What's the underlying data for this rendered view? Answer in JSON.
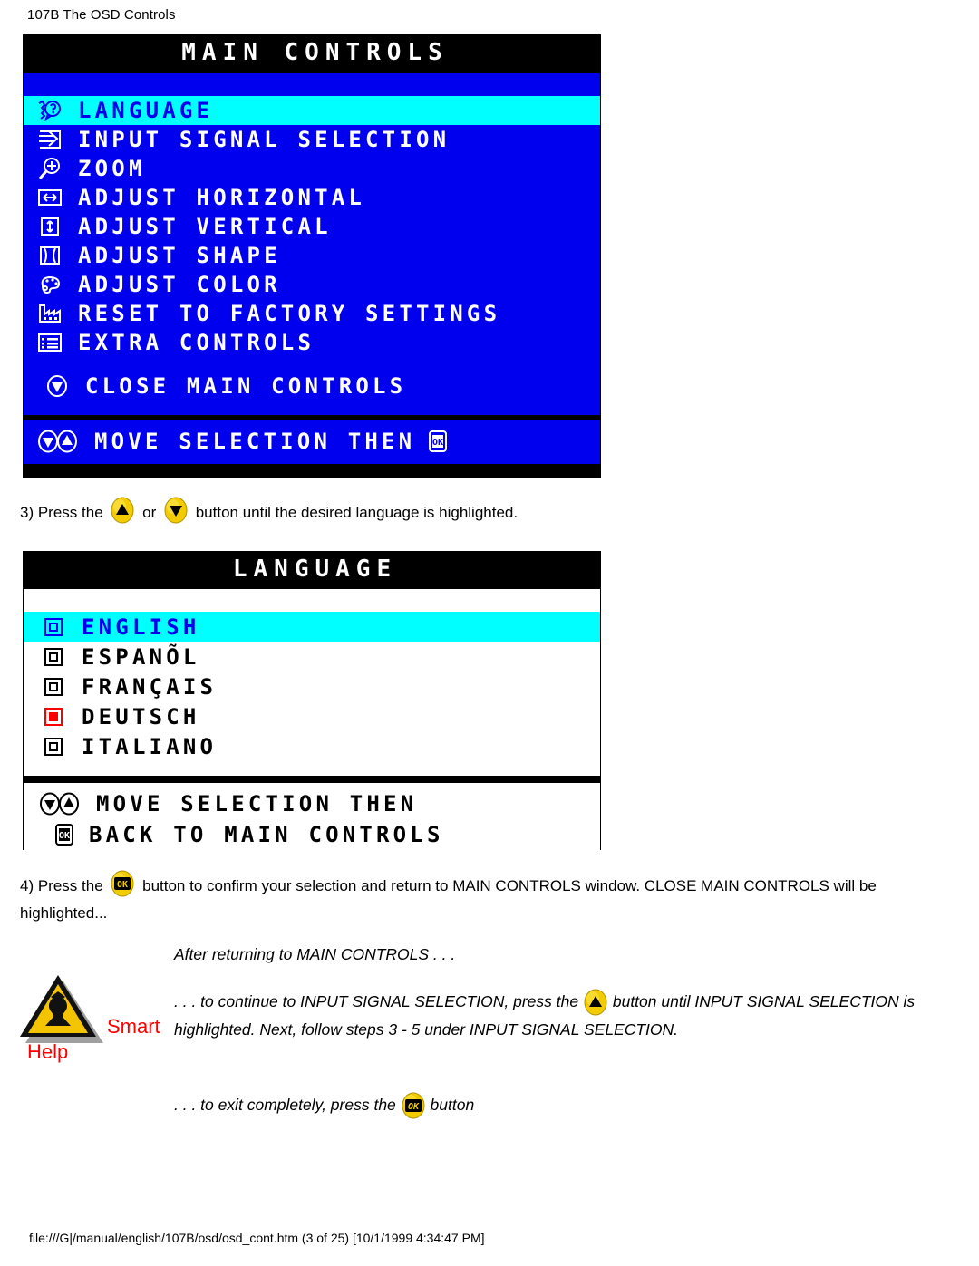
{
  "page": {
    "header": "107B The OSD Controls",
    "footer": "file:///G|/manual/english/107B/osd/osd_cont.htm (3 of 25) [10/1/1999 4:34:47 PM]"
  },
  "colors": {
    "osd_blue": "#0000EE",
    "osd_highlight_cyan": "#00FFFF",
    "osd_title_bg": "#000000",
    "osd_text_white": "#FFFFFF",
    "selected_radio_red": "#FF0000",
    "button_yellow": "#F2CC00",
    "smart_help_red": "#FF0000"
  },
  "main_controls": {
    "title": "MAIN CONTROLS",
    "items": [
      {
        "label": "LANGUAGE",
        "icon": "language-face-question-icon",
        "highlighted": true
      },
      {
        "label": "INPUT SIGNAL SELECTION",
        "icon": "input-signal-arrow-icon",
        "highlighted": false
      },
      {
        "label": "ZOOM",
        "icon": "magnifier-plus-icon",
        "highlighted": false
      },
      {
        "label": "ADJUST HORIZONTAL",
        "icon": "horizontal-arrows-icon",
        "highlighted": false
      },
      {
        "label": "ADJUST VERTICAL",
        "icon": "vertical-arrows-icon",
        "highlighted": false
      },
      {
        "label": "ADJUST SHAPE",
        "icon": "shape-pincushion-icon",
        "highlighted": false
      },
      {
        "label": "ADJUST COLOR",
        "icon": "color-palette-icon",
        "highlighted": false
      },
      {
        "label": "RESET TO FACTORY SETTINGS",
        "icon": "factory-icon",
        "highlighted": false
      },
      {
        "label": "EXTRA CONTROLS",
        "icon": "list-menu-icon",
        "highlighted": false
      }
    ],
    "close_item": {
      "label": "CLOSE MAIN CONTROLS",
      "icon": "down-arrow-round-icon"
    },
    "footer": {
      "label": "MOVE SELECTION THEN",
      "lead_icon": "down-up-buttons-icon",
      "trail_icon": "ok-button-icon"
    }
  },
  "language_panel": {
    "title": "LANGUAGE",
    "options": [
      {
        "label": "ENGLISH",
        "radio": "radio-outline",
        "selected": false,
        "highlighted": true
      },
      {
        "label": "ESPANÕL",
        "radio": "radio-outline",
        "selected": false,
        "highlighted": false
      },
      {
        "label": "FRANÇAIS",
        "radio": "radio-outline",
        "selected": false,
        "highlighted": false
      },
      {
        "label": "DEUTSCH",
        "radio": "radio-filled-red",
        "selected": true,
        "highlighted": false
      },
      {
        "label": "ITALIANO",
        "radio": "radio-outline",
        "selected": false,
        "highlighted": false
      }
    ],
    "footer_line1": {
      "label": "MOVE SELECTION THEN",
      "lead_icon": "down-up-buttons-icon"
    },
    "footer_line2": {
      "label": "BACK TO MAIN CONTROLS",
      "lead_icon": "ok-button-icon"
    }
  },
  "step3": {
    "part1": "3) Press the",
    "or": "or",
    "part2": "button until the desired language is highlighted.",
    "up_button": "up-button-icon",
    "down_button": "down-button-icon"
  },
  "step4": {
    "part1": "4) Press the",
    "part2": "button to confirm your selection and return to MAIN CONTROLS window. CLOSE MAIN CONTROLS will be highlighted...",
    "ok_button": "ok-button-icon"
  },
  "smart_help": {
    "smart": "Smart",
    "help": "Help",
    "icon": "warning-triangle-icon",
    "line1": "After returning to MAIN CONTROLS . . .",
    "line2_part1": ". . . to continue to INPUT SIGNAL SELECTION, press the",
    "line2_part2": "button until INPUT SIGNAL SELECTION is highlighted. Next, follow steps 3 - 5 under INPUT SIGNAL SELECTION.",
    "line2_button": "up-button-icon",
    "line3_part1": ". . . to exit completely, press the",
    "line3_part2": "button",
    "line3_button": "ok-button-icon"
  }
}
